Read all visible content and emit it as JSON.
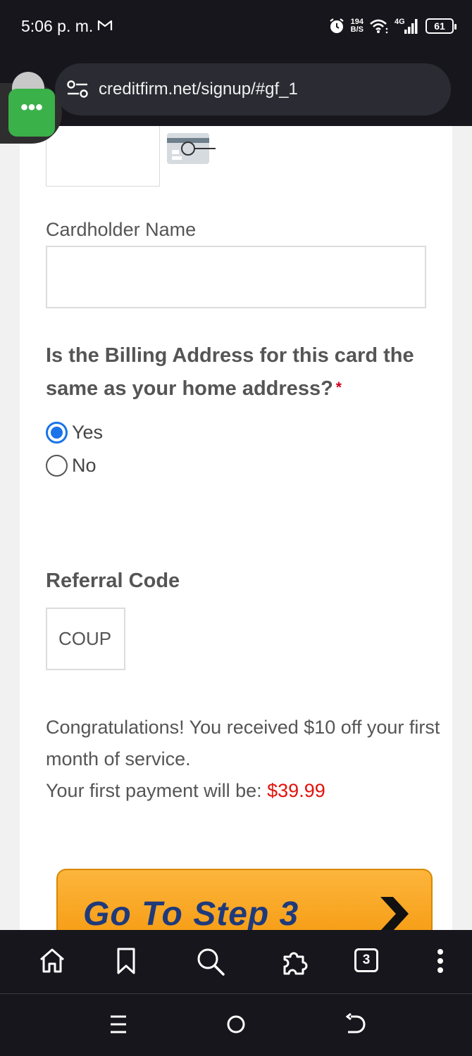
{
  "status_bar": {
    "time": "5:06 p. m.",
    "net_speed_value": "194",
    "net_speed_unit": "B/S",
    "network": "4G",
    "battery": "61"
  },
  "browser": {
    "url": "creditfirm.net/signup/#gf_1"
  },
  "bubble": {
    "label": "•••"
  },
  "form": {
    "cardholder_label": "Cardholder Name",
    "cardholder_value": "",
    "billing_question": "Is the Billing Address for this card the same as your home address?",
    "required_mark": "*",
    "options": [
      {
        "label": "Yes",
        "selected": true
      },
      {
        "label": "No",
        "selected": false
      }
    ],
    "referral_label": "Referral Code",
    "referral_value": "COUP",
    "congrats_text": "Congratulations! You received $10 off your first month of service.",
    "payment_text": "Your first payment will be: ",
    "payment_amount": "$39.99",
    "step_button": "Go To Step 3"
  },
  "toolbar": {
    "tabs_count": "3"
  },
  "colors": {
    "accent": "#1a73e8",
    "price": "#e3120b",
    "button": "#f5a623",
    "bubble": "#3bb14a"
  }
}
